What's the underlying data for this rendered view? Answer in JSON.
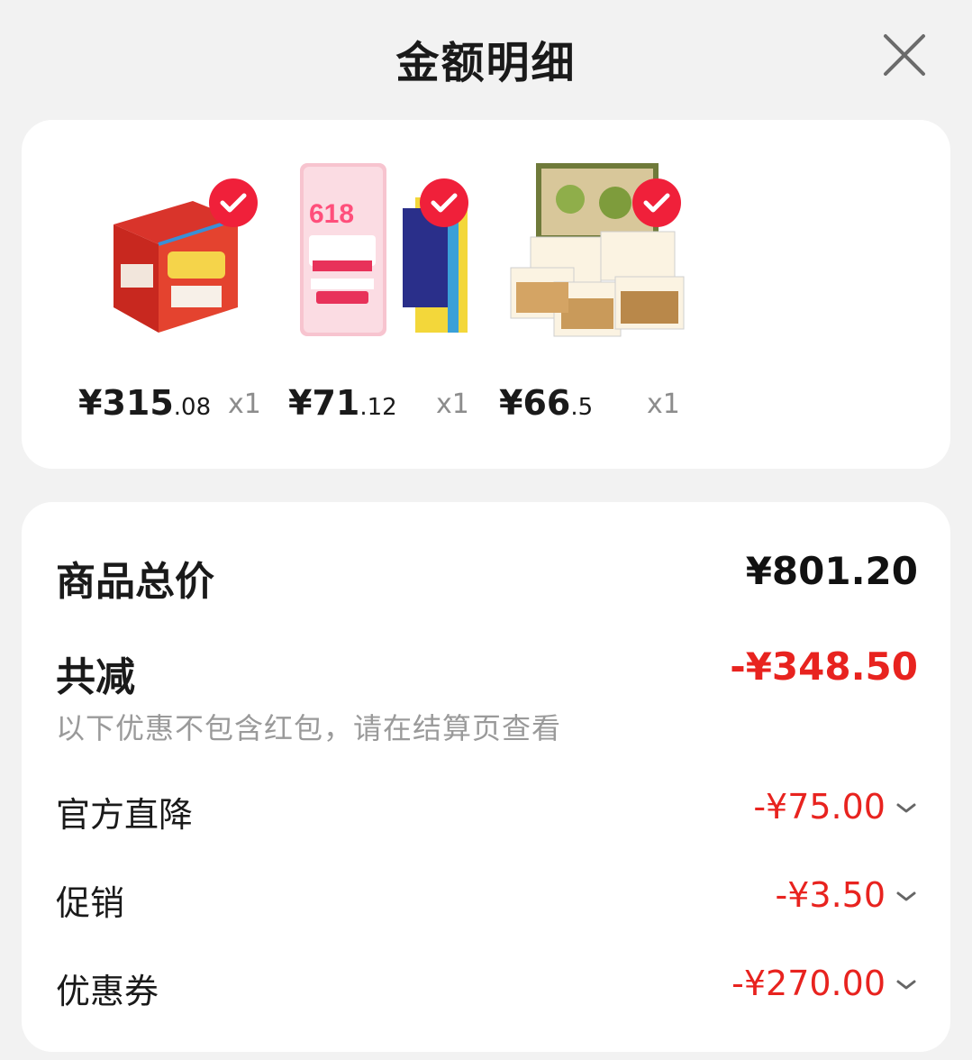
{
  "header": {
    "title": "金额明细"
  },
  "products": [
    {
      "price_int": "¥315",
      "price_dec": ".08",
      "qty": "x1"
    },
    {
      "price_int": "¥71",
      "price_dec": ".12",
      "qty": "x1"
    },
    {
      "price_int": "¥66",
      "price_dec": ".5",
      "qty": "x1"
    }
  ],
  "summary": {
    "total_label": "商品总价",
    "total_value": "¥801.20",
    "reduce_label": "共减",
    "reduce_value": "-¥348.50",
    "note": "以下优惠不包含红包，请在结算页查看",
    "details": [
      {
        "label": "官方直降",
        "value": "-¥75.00",
        "icon": "chevron-down-icon"
      },
      {
        "label": "促销",
        "value": "-¥3.50",
        "icon": "chevron-down-icon"
      },
      {
        "label": "优惠券",
        "value": "-¥270.00",
        "icon": "chevron-down-icon"
      }
    ]
  },
  "colors": {
    "accent_red": "#e8231f",
    "check_red": "#f0203a",
    "background": "#f2f2f2"
  }
}
